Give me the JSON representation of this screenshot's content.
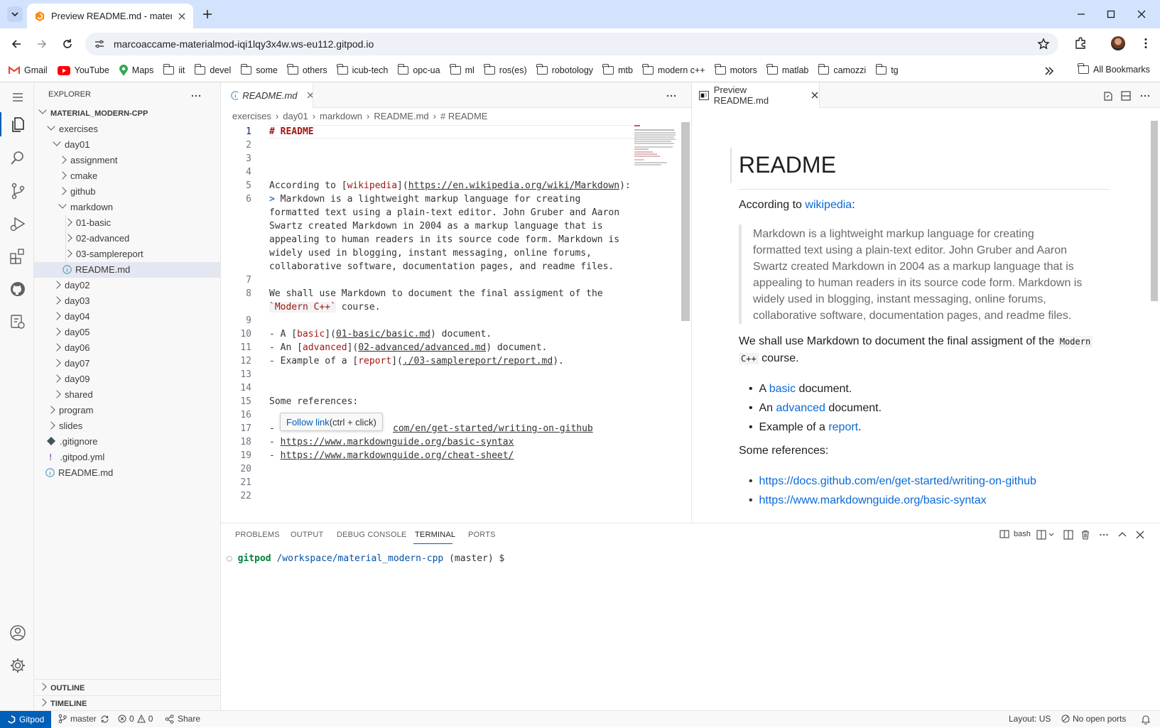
{
  "browser": {
    "tab_title": "Preview README.md - material_",
    "url": "marcoaccame-materialmod-iqi1lqy3x4w.ws-eu112.gitpod.io",
    "bookmarks": [
      "Gmail",
      "YouTube",
      "Maps",
      "iit",
      "devel",
      "some",
      "others",
      "icub-tech",
      "opc-ua",
      "ml",
      "ros(es)",
      "robotology",
      "mtb",
      "modern c++",
      "motors",
      "matlab",
      "camozzi",
      "tg"
    ],
    "all_bookmarks": "All Bookmarks"
  },
  "explorer": {
    "title": "EXPLORER",
    "root": "MATERIAL_MODERN-CPP",
    "items": [
      "exercises",
      "day01",
      "assignment",
      "cmake",
      "github",
      "markdown",
      "01-basic",
      "02-advanced",
      "03-samplereport",
      "README.md",
      "day02",
      "day03",
      "day04",
      "day05",
      "day06",
      "day07",
      "day09",
      "shared",
      "program",
      "slides",
      ".gitignore",
      ".gitpod.yml",
      "README.md"
    ],
    "outline": "OUTLINE",
    "timeline": "TIMELINE"
  },
  "editor": {
    "tab": "README.md",
    "breadcrumb": [
      "exercises",
      "day01",
      "markdown",
      "README.md",
      "# README"
    ],
    "line_numbers": [
      "1",
      "2",
      "3",
      "4",
      "5",
      "6",
      "7",
      "8",
      "9",
      "10",
      "11",
      "12",
      "13",
      "14",
      "15",
      "16",
      "17",
      "18",
      "19",
      "20",
      "21",
      "22"
    ],
    "l1": "# README",
    "l5a": "According to [",
    "l5b": "wikipedia",
    "l5c": "](",
    "l5d": "https://en.wikipedia.org/wiki/Markdown",
    "l5e": "):",
    "l6a": "> ",
    "l6b": "Markdown is a lightweight markup language for creating",
    "l6c": "formatted text using a plain-text editor. John Gruber and Aaron",
    "l6d": "Swartz created Markdown in 2004 as a markup language that is",
    "l6e": "appealing to human readers in its source code form. Markdown is",
    "l6f": "widely used in blogging, instant messaging, online forums,",
    "l6g": "collaborative software, documentation pages, and readme files.",
    "l8a": "We shall use Markdown to document the final assigment of the",
    "l8b": "`Modern C++`",
    "l8c": " course.",
    "l10a": "- A [",
    "l10b": "basic",
    "l10c": "](",
    "l10d": "01-basic/basic.md",
    "l10e": ") document.",
    "l11a": "- An [",
    "l11b": "advanced",
    "l11c": "](",
    "l11d": "02-advanced/advanced.md",
    "l11e": ") document.",
    "l12a": "- Example of a [",
    "l12b": "report",
    "l12c": "](",
    "l12d": "./03-samplereport/report.md",
    "l12e": ").",
    "l15": "Some references:",
    "l17a": "- ",
    "l17b": "com/en/get-started/writing-on-github",
    "l18a": "- ",
    "l18b": "https://www.markdownguide.org/basic-syntax",
    "l19a": "- ",
    "l19b": "https://www.markdownguide.org/cheat-sheet/",
    "hover_link": "Follow link",
    "hover_hint": " (ctrl + click)"
  },
  "preview": {
    "tab": "Preview README.md",
    "h1": "README",
    "p1a": "According to ",
    "p1link": "wikipedia",
    "p1b": ":",
    "quote1": "Markdown is a lightweight markup language for creating",
    "quote2": "formatted text using a plain-text editor. John Gruber and Aaron",
    "quote3": "Swartz created Markdown in 2004 as a markup language that is",
    "quote4": "appealing to human readers in its source code form. Markdown is",
    "quote5": "widely used in blogging, instant messaging, online forums,",
    "quote6": "collaborative software, documentation pages, and readme files.",
    "p2a": "We shall use Markdown to document the final assigment of the",
    "p2code1": "Modern",
    "p2code2": "C++",
    "p2b": " course.",
    "li1a": "A ",
    "li1link": "basic",
    "li1b": " document.",
    "li2a": "An ",
    "li2link": "advanced",
    "li2b": " document.",
    "li3a": "Example of a ",
    "li3link": "report",
    "li3b": ".",
    "p3": "Some references:",
    "ref1": "https://docs.github.com/en/get-started/writing-on-github",
    "ref2": "https://www.markdownguide.org/basic-syntax"
  },
  "panel": {
    "tabs": [
      "PROBLEMS",
      "OUTPUT",
      "DEBUG CONSOLE",
      "TERMINAL",
      "PORTS"
    ],
    "shell": "bash",
    "prompt_user": "gitpod",
    "prompt_path": "/workspace/material_modern-cpp",
    "prompt_branch": "(master) $"
  },
  "status": {
    "gitpod": "Gitpod",
    "branch": "master",
    "errors": "0",
    "warnings": "0",
    "share": "Share",
    "layout": "Layout: US",
    "ports": "No open ports"
  }
}
